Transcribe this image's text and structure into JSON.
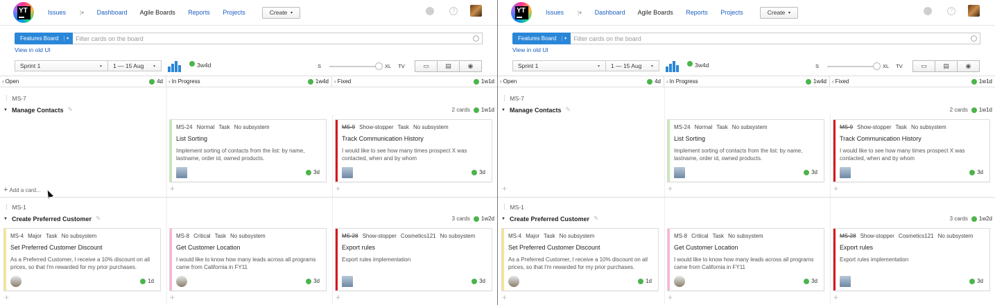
{
  "header": {
    "logo_text": "YT",
    "nav": {
      "issues": "Issues",
      "dashboard": "Dashboard",
      "agile": "Agile Boards",
      "reports": "Reports",
      "projects": "Projects"
    },
    "create_label": "Create",
    "help_label": "?"
  },
  "board": {
    "name": "Features Board",
    "search_placeholder": "Filter cards on the board",
    "old_ui_link": "View in old UI"
  },
  "toolbar": {
    "sprint": "Sprint 1",
    "date_range": "1 — 15 Aug",
    "sprint_estimate": "3w4d",
    "size_small": "S",
    "size_xl": "XL",
    "tv": "TV",
    "zoom_level": 1.0
  },
  "columns": [
    {
      "name": "Open",
      "estimate": "4d"
    },
    {
      "name": "In Progress",
      "estimate": "1w4d"
    },
    {
      "name": "Fixed",
      "estimate": "1w1d"
    }
  ],
  "swimlanes": [
    {
      "id": "MS-7",
      "title": "Manage Contacts",
      "count": "2 cards",
      "estimate": "1w1d",
      "add_card": "Add a card...",
      "cards": [
        {
          "id": "MS-24",
          "priority": "Normal",
          "type": "Task",
          "subsystem": "No subsystem",
          "title": "List Sorting",
          "desc": "Implement sorting of contacts from the list: by name, lastname, order id, owned products.",
          "estimate": "3d",
          "color": "#c6e8b4"
        },
        {
          "id": "MS-9",
          "priority": "Show-stopper",
          "type": "Task",
          "subsystem": "No subsystem",
          "title": "Track Communication History",
          "desc": "I would like to see how many times prospect X was contacted, when and by whom",
          "estimate": "3d",
          "color": "#d8161b"
        }
      ]
    },
    {
      "id": "MS-1",
      "title": "Create Preferred Customer",
      "count": "3 cards",
      "estimate": "1w2d",
      "cards": [
        {
          "id": "MS-4",
          "priority": "Major",
          "type": "Task",
          "subsystem": "No subsystem",
          "title": "Set Preferred Customer Discount",
          "desc": "As a Preferred Customer, I receive a 10% discount on all prices, so that I'm rewarded for my prior purchases.",
          "estimate": "1d",
          "color": "#f8e58c"
        },
        {
          "id": "MS-8",
          "priority": "Critical",
          "type": "Task",
          "subsystem": "No subsystem",
          "title": "Get Customer Location",
          "desc": "I would like to know how many leads across all programs came from California in FY11",
          "estimate": "3d",
          "color": "#f5b5d6"
        },
        {
          "id": "MS-28",
          "priority": "Show-stopper",
          "project": "Cosmetics121",
          "subsystem": "No subsystem",
          "title": "Export rules",
          "desc": "Export rules implementation",
          "estimate": "3d",
          "color": "#d8161b"
        }
      ]
    }
  ],
  "colors": {
    "accent": "#2a87d8",
    "link": "#1a5dc1",
    "estimate_dot": "#4bb44b"
  }
}
